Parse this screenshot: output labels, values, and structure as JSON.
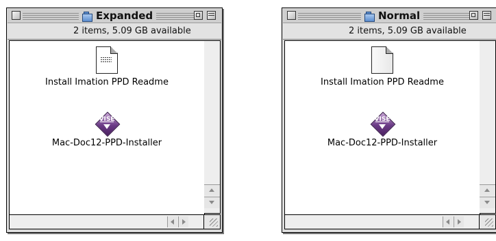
{
  "windows": [
    {
      "title": "Expanded",
      "info": "2 items, 5.09 GB available",
      "items": [
        {
          "label": "Install Imation PPD Readme",
          "icon": "text-document-icon"
        },
        {
          "label": "Mac-Doc12-PPD-Installer",
          "icon": "vise-installer-icon"
        }
      ]
    },
    {
      "title": "Normal",
      "info": "2 items, 5.09 GB available",
      "items": [
        {
          "label": "Install Imation PPD Readme",
          "icon": "blank-document-icon"
        },
        {
          "label": "Mac-Doc12-PPD-Installer",
          "icon": "vise-installer-icon"
        }
      ]
    }
  ],
  "vise_icon_text": "VISE",
  "colors": {
    "titlebar": "#cfcfcf",
    "folder_blue": "#5d8fd0",
    "vise_purple": "#6b3b86"
  }
}
